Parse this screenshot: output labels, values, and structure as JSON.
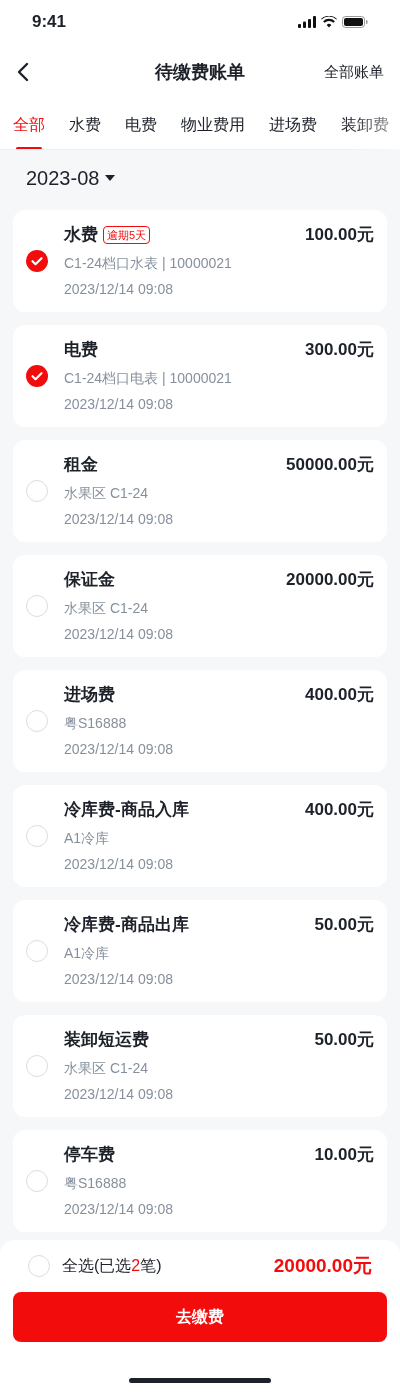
{
  "status_bar": {
    "time": "9:41"
  },
  "nav": {
    "title": "待缴费账单",
    "action": "全部账单"
  },
  "tabs": [
    {
      "label": "全部",
      "selected": true
    },
    {
      "label": "水费",
      "selected": false
    },
    {
      "label": "电费",
      "selected": false
    },
    {
      "label": "物业费用",
      "selected": false
    },
    {
      "label": "进场费",
      "selected": false
    },
    {
      "label": "装卸费",
      "selected": false
    }
  ],
  "month": "2023-08",
  "bills": [
    {
      "name": "水费",
      "badge": "逾期5天",
      "detail": "C1-24档口水表 | 10000021",
      "time": "2023/12/14 09:08",
      "amount": "100.00元",
      "checked": true
    },
    {
      "name": "电费",
      "detail": "C1-24档口电表 | 10000021",
      "time": "2023/12/14 09:08",
      "amount": "300.00元",
      "checked": true
    },
    {
      "name": "租金",
      "detail": "水果区 C1-24",
      "time": "2023/12/14 09:08",
      "amount": "50000.00元",
      "checked": false
    },
    {
      "name": "保证金",
      "detail": "水果区 C1-24",
      "time": "2023/12/14 09:08",
      "amount": "20000.00元",
      "checked": false
    },
    {
      "name": "进场费",
      "detail": "粤S16888",
      "time": "2023/12/14 09:08",
      "amount": "400.00元",
      "checked": false
    },
    {
      "name": "冷库费-商品入库",
      "detail": "A1冷库",
      "time": "2023/12/14 09:08",
      "amount": "400.00元",
      "checked": false
    },
    {
      "name": "冷库费-商品出库",
      "detail": "A1冷库",
      "time": "2023/12/14 09:08",
      "amount": "50.00元",
      "checked": false
    },
    {
      "name": "装卸短运费",
      "detail": "水果区 C1-24",
      "time": "2023/12/14 09:08",
      "amount": "50.00元",
      "checked": false
    },
    {
      "name": "停车费",
      "detail": "粤S16888",
      "time": "2023/12/14 09:08",
      "amount": "10.00元",
      "checked": false
    }
  ],
  "footer": {
    "select_all_checked": false,
    "label_before": "全选(已选",
    "count": "2",
    "label_after": "笔)",
    "total": "20000.00元",
    "pay_button": "去缴费"
  }
}
